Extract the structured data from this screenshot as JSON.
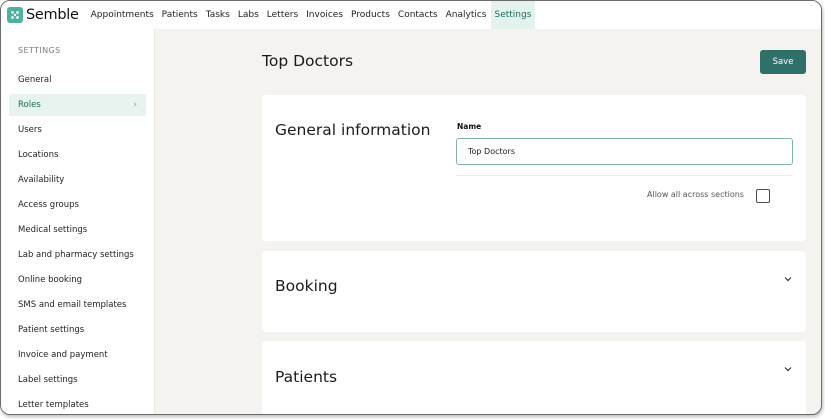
{
  "brand": {
    "name": "Semble",
    "accent": "#4fb39c"
  },
  "topnav": {
    "items": [
      {
        "label": "Appointments"
      },
      {
        "label": "Patients"
      },
      {
        "label": "Tasks"
      },
      {
        "label": "Labs"
      },
      {
        "label": "Letters"
      },
      {
        "label": "Invoices"
      },
      {
        "label": "Products"
      },
      {
        "label": "Contacts"
      },
      {
        "label": "Analytics"
      },
      {
        "label": "Settings",
        "active": true
      }
    ]
  },
  "sidebar": {
    "heading": "SETTINGS",
    "items": [
      {
        "label": "General"
      },
      {
        "label": "Roles",
        "active": true
      },
      {
        "label": "Users"
      },
      {
        "label": "Locations"
      },
      {
        "label": "Availability"
      },
      {
        "label": "Access groups"
      },
      {
        "label": "Medical settings"
      },
      {
        "label": "Lab and pharmacy settings"
      },
      {
        "label": "Online booking"
      },
      {
        "label": "SMS and email templates"
      },
      {
        "label": "Patient settings"
      },
      {
        "label": "Invoice and payment"
      },
      {
        "label": "Label settings"
      },
      {
        "label": "Letter templates"
      }
    ]
  },
  "main": {
    "title": "Top Doctors",
    "save_label": "Save",
    "sections": {
      "general": {
        "title": "General information",
        "name_label": "Name",
        "name_value": "Top Doctors",
        "allow_label": "Allow all across sections",
        "allow_checked": false
      },
      "booking": {
        "title": "Booking"
      },
      "patients": {
        "title": "Patients"
      }
    }
  },
  "colors": {
    "primary_button": "#2f7068",
    "active_bg": "#e6f3ee",
    "active_text": "#1e6b5b"
  }
}
